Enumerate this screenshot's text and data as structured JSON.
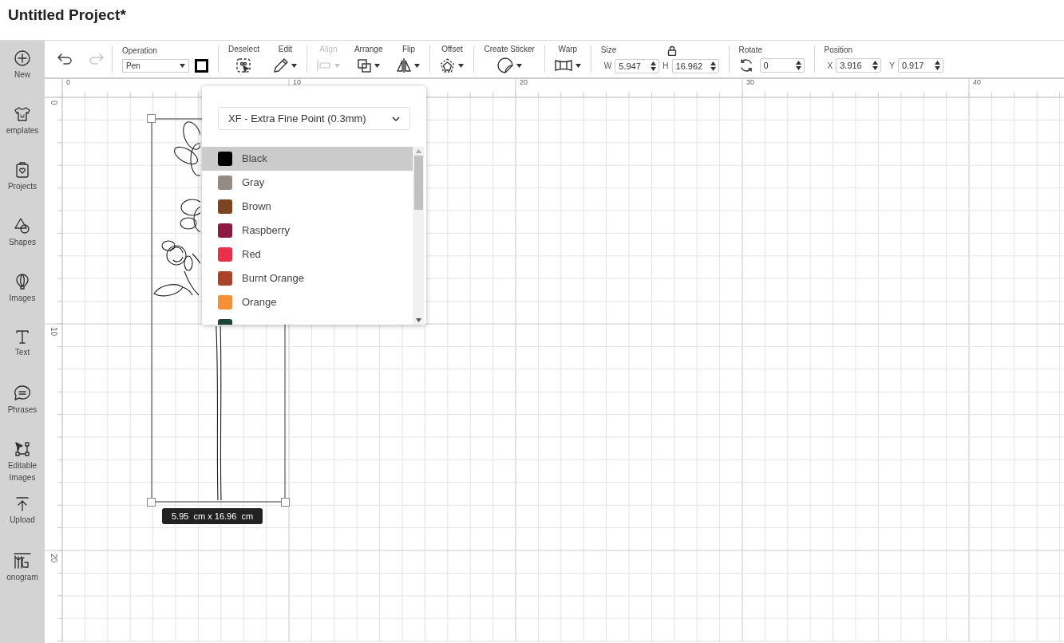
{
  "title": "Untitled Project*",
  "sidebar": {
    "items": [
      {
        "label": "New"
      },
      {
        "label": "emplates"
      },
      {
        "label": "Projects"
      },
      {
        "label": "Shapes"
      },
      {
        "label": "Images"
      },
      {
        "label": "Text"
      },
      {
        "label": "Phrases"
      },
      {
        "label": "Editable Images"
      },
      {
        "label": "Upload"
      },
      {
        "label": "onogram"
      }
    ]
  },
  "toolbar": [
    {
      "kind": "history",
      "undo": {
        "disabled": false
      },
      "redo": {
        "disabled": true
      }
    },
    {
      "kind": "operation",
      "label": "Operation",
      "value": "Pen"
    },
    {
      "kind": "tools",
      "items": [
        {
          "label": "Deselect",
          "disabled": false,
          "caret": false
        },
        {
          "label": "Edit",
          "disabled": false,
          "caret": true
        }
      ]
    },
    {
      "kind": "tools",
      "items": [
        {
          "label": "Align",
          "disabled": true,
          "caret": true
        },
        {
          "label": "Arrange",
          "disabled": false,
          "caret": true
        },
        {
          "label": "Flip",
          "disabled": false,
          "caret": true
        }
      ]
    },
    {
      "kind": "tools",
      "items": [
        {
          "label": "Offset",
          "disabled": false,
          "caret": true
        }
      ]
    },
    {
      "kind": "tools",
      "items": [
        {
          "label": "Create Sticker",
          "disabled": false,
          "caret": true
        }
      ]
    },
    {
      "kind": "tools",
      "items": [
        {
          "label": "Warp",
          "disabled": false,
          "caret": true
        }
      ]
    },
    {
      "kind": "size",
      "label": "Size",
      "width": {
        "label": "W",
        "value": "5.947"
      },
      "height": {
        "label": "H",
        "value": "16.962"
      }
    },
    {
      "kind": "rotate",
      "label": "Rotate",
      "value": "0"
    },
    {
      "kind": "position",
      "label": "Position",
      "x": {
        "label": "X",
        "value": "3.916"
      },
      "y": {
        "label": "Y",
        "value": "0.917"
      }
    }
  ],
  "rulers": {
    "x_labels": [
      "0",
      "10",
      "20",
      "30",
      "40"
    ],
    "y_labels": [
      "0",
      "10",
      "20"
    ]
  },
  "selection": {
    "dimensions": "5.95  cm x 16.96  cm"
  },
  "pen_popup": {
    "pen_type": "XF - Extra Fine Point (0.3mm)",
    "colors": [
      {
        "label": "Black",
        "color": "#000000",
        "selected": true
      },
      {
        "label": "Gray",
        "color": "#958b84",
        "selected": false
      },
      {
        "label": "Brown",
        "color": "#7a4520",
        "selected": false
      },
      {
        "label": "Raspberry",
        "color": "#8b1a40",
        "selected": false
      },
      {
        "label": "Red",
        "color": "#e8304a",
        "selected": false
      },
      {
        "label": "Burnt Orange",
        "color": "#a9432a",
        "selected": false
      },
      {
        "label": "Orange",
        "color": "#f58f38",
        "selected": false
      },
      {
        "color": "#1d4437",
        "selected": false
      }
    ]
  }
}
